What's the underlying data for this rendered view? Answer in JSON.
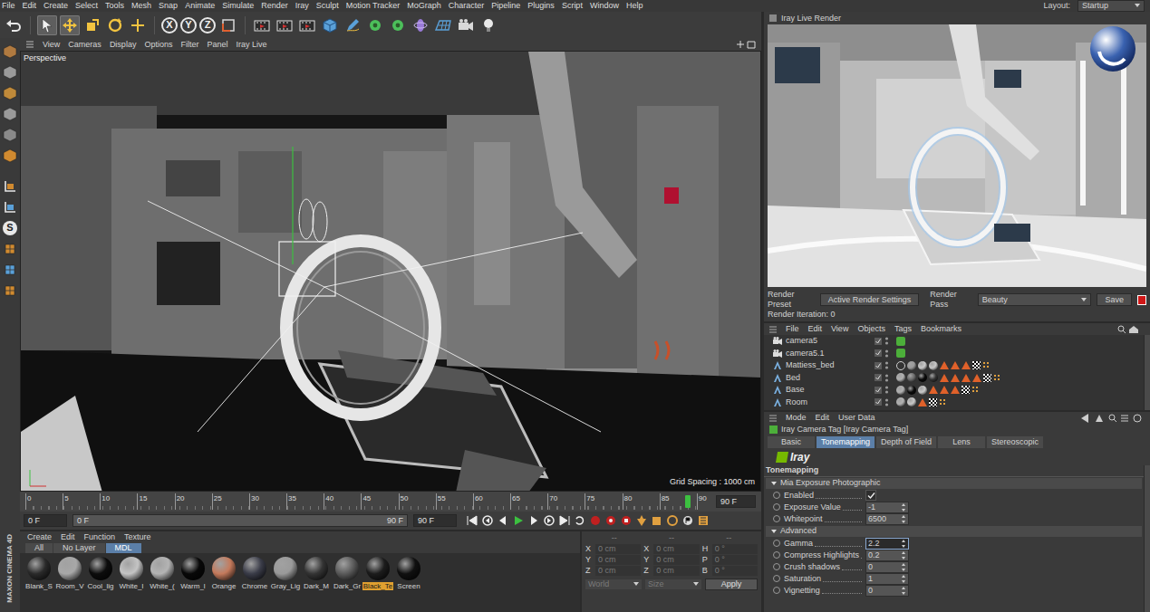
{
  "menu_bar": {
    "items": [
      "File",
      "Edit",
      "Create",
      "Select",
      "Tools",
      "Mesh",
      "Snap",
      "Animate",
      "Simulate",
      "Render",
      "Iray",
      "Sculpt",
      "Motion Tracker",
      "MoGraph",
      "Character",
      "Pipeline",
      "Plugins",
      "Script",
      "Window",
      "Help"
    ],
    "layout_label": "Layout:",
    "layout_value": "Startup"
  },
  "toolbar": {
    "tools": [
      {
        "kind": "select",
        "selected": true
      },
      {
        "kind": "move",
        "selected": true
      },
      {
        "kind": "scale",
        "selected": false
      },
      {
        "kind": "rotate",
        "selected": false
      },
      {
        "kind": "add",
        "selected": false
      }
    ],
    "axes": [
      "X",
      "Y",
      "Z"
    ]
  },
  "left_toolbar": {
    "snap_label": "S"
  },
  "viewport": {
    "menu": [
      "View",
      "Cameras",
      "Display",
      "Options",
      "Filter",
      "Panel",
      "Iray Live"
    ],
    "label": "Perspective",
    "grid_spacing": "Grid Spacing : 1000 cm"
  },
  "timeline": {
    "ticks": [
      "0",
      "5",
      "10",
      "15",
      "20",
      "25",
      "30",
      "35",
      "40",
      "45",
      "50",
      "55",
      "60",
      "65",
      "70",
      "75",
      "80",
      "85",
      "90"
    ],
    "playhead_level": 0.985,
    "end_field": "90 F"
  },
  "transport": {
    "current": "0 F",
    "range_start": "0 F",
    "range_end": "90 F",
    "max": "90 F"
  },
  "material_manager": {
    "menu": [
      "Create",
      "Edit",
      "Function",
      "Texture"
    ],
    "tabs": [
      {
        "label": "All",
        "selected": false
      },
      {
        "label": "No Layer",
        "selected": false
      },
      {
        "label": "MDL",
        "selected": true
      }
    ],
    "materials": [
      {
        "name": "Blank_S",
        "color": "#2a2a2a",
        "selected": false
      },
      {
        "name": "Room_V",
        "color": "#a8a8a8",
        "selected": false
      },
      {
        "name": "Cool_lig",
        "color": "#0c0c0c",
        "selected": false
      },
      {
        "name": "White_I",
        "color": "#c4c4c4",
        "selected": false
      },
      {
        "name": "White_(",
        "color": "#b4b4b4",
        "selected": false
      },
      {
        "name": "Warm_l",
        "color": "#080808",
        "selected": false
      },
      {
        "name": "Orange",
        "color": "#c47a5c",
        "selected": false
      },
      {
        "name": "Chrome",
        "color": "#3a3c48",
        "selected": false
      },
      {
        "name": "Gray_Lig",
        "color": "#9a9a9a",
        "selected": false
      },
      {
        "name": "Dark_M",
        "color": "#343434",
        "selected": false
      },
      {
        "name": "Dark_Gr",
        "color": "#5a5a5a",
        "selected": false
      },
      {
        "name": "Black_Te",
        "color": "#1c1c1c",
        "selected": true
      },
      {
        "name": "Screen",
        "color": "#101010",
        "selected": false
      }
    ]
  },
  "coordinates": {
    "headers": [
      "--",
      "--",
      "--"
    ],
    "rows": [
      {
        "axis": "X",
        "pos": "0 cm",
        "size_axis": "X",
        "size": "0 cm",
        "rot_axis": "H",
        "rot": "0 °"
      },
      {
        "axis": "Y",
        "pos": "0 cm",
        "size_axis": "Y",
        "size": "0 cm",
        "rot_axis": "P",
        "rot": "0 °"
      },
      {
        "axis": "Z",
        "pos": "0 cm",
        "size_axis": "Z",
        "size": "0 cm",
        "rot_axis": "B",
        "rot": "0 °"
      }
    ],
    "disabled": true,
    "dropdowns": [
      "World",
      "Size"
    ],
    "apply": "Apply"
  },
  "brand": "MAXON CINEMA 4D",
  "render_view": {
    "title": "Iray Live Render",
    "preset_label": "Render Preset",
    "preset_value": "Active Render Settings",
    "pass_label": "Render Pass",
    "pass_value": "Beauty",
    "save": "Save",
    "iteration": "Render Iteration: 0"
  },
  "object_manager": {
    "menu": [
      "File",
      "Edit",
      "View",
      "Objects",
      "Tags",
      "Bookmarks"
    ],
    "objects": [
      {
        "name": "camera5",
        "kind": "camera",
        "tags": [
          {
            "kind": "iray",
            "color": "#4caf3a"
          }
        ]
      },
      {
        "name": "camera5.1",
        "kind": "camera",
        "tags": [
          {
            "kind": "iray",
            "color": "#4caf3a"
          }
        ]
      },
      {
        "name": "Mattiess_bed",
        "kind": "object",
        "tags": [
          {
            "kind": "ring",
            "color": "#d0d0d0"
          },
          {
            "kind": "sphere",
            "color": "#9a9a9a"
          },
          {
            "kind": "sphere",
            "color": "#c8c8c8"
          },
          {
            "kind": "sphere",
            "color": "#c8c8c8"
          },
          {
            "kind": "triangle",
            "color": "#e0612a"
          },
          {
            "kind": "triangle",
            "color": "#e0612a"
          },
          {
            "kind": "triangle",
            "color": "#e0612a"
          },
          {
            "kind": "checker",
            "color": "#ffffff"
          },
          {
            "kind": "dots",
            "color": "#e0a040"
          }
        ]
      },
      {
        "name": "Bed",
        "kind": "object",
        "tags": [
          {
            "kind": "sphere",
            "color": "#b0b0b0"
          },
          {
            "kind": "sphere",
            "color": "#6a6a6a"
          },
          {
            "kind": "sphere",
            "color": "#0a0a0a"
          },
          {
            "kind": "sphere",
            "color": "#333333"
          },
          {
            "kind": "triangle",
            "color": "#e0612a"
          },
          {
            "kind": "triangle",
            "color": "#e0612a"
          },
          {
            "kind": "triangle",
            "color": "#e0612a"
          },
          {
            "kind": "triangle",
            "color": "#e0612a"
          },
          {
            "kind": "checker",
            "color": "#ffffff"
          },
          {
            "kind": "dots",
            "color": "#e0a040"
          }
        ]
      },
      {
        "name": "Base",
        "kind": "object",
        "tags": [
          {
            "kind": "sphere",
            "color": "#b0b0b0"
          },
          {
            "kind": "sphere",
            "color": "#0a0a0a"
          },
          {
            "kind": "sphere",
            "color": "#c8c8c8"
          },
          {
            "kind": "triangle",
            "color": "#e0612a"
          },
          {
            "kind": "triangle",
            "color": "#e0612a"
          },
          {
            "kind": "triangle",
            "color": "#e0612a"
          },
          {
            "kind": "checker",
            "color": "#ffffff"
          },
          {
            "kind": "dots",
            "color": "#e0a040"
          }
        ]
      },
      {
        "name": "Room",
        "kind": "object",
        "tags": [
          {
            "kind": "sphere",
            "color": "#b0b0b0"
          },
          {
            "kind": "sphere",
            "color": "#c8c8c8"
          },
          {
            "kind": "triangle",
            "color": "#e0612a"
          },
          {
            "kind": "checker",
            "color": "#ffffff"
          },
          {
            "kind": "dots",
            "color": "#e0a040"
          }
        ]
      }
    ]
  },
  "attribute_manager": {
    "menu": [
      "Mode",
      "Edit",
      "User Data"
    ],
    "title": "Iray Camera Tag [Iray Camera Tag]",
    "tabs": [
      {
        "label": "Basic",
        "selected": false
      },
      {
        "label": "Tonemapping",
        "selected": true
      },
      {
        "label": "Depth of Field",
        "selected": false
      },
      {
        "label": "Lens",
        "selected": false
      },
      {
        "label": "Stereoscopic",
        "selected": false
      }
    ],
    "logo": "Iray",
    "section": "Tonemapping",
    "groups": [
      {
        "title": "Mia Exposure Photographic",
        "expanded": true,
        "params": [
          {
            "label": "Enabled",
            "kind": "check",
            "checked": true
          },
          {
            "label": "Exposure Value",
            "kind": "number",
            "value": "-1",
            "editing": false
          },
          {
            "label": "Whitepoint",
            "kind": "number",
            "value": "6500",
            "editing": false
          }
        ]
      },
      {
        "title": "Advanced",
        "expanded": true,
        "params": [
          {
            "label": "Gamma",
            "kind": "number",
            "value": "2.2",
            "editing": true
          },
          {
            "label": "Compress Highlights",
            "kind": "number",
            "value": "0.2",
            "editing": false
          },
          {
            "label": "Crush shadows",
            "kind": "number",
            "value": "0",
            "editing": false
          },
          {
            "label": "Saturation",
            "kind": "number",
            "value": "1",
            "editing": false
          },
          {
            "label": "Vignetting",
            "kind": "number",
            "value": "0",
            "editing": false
          }
        ]
      }
    ]
  }
}
